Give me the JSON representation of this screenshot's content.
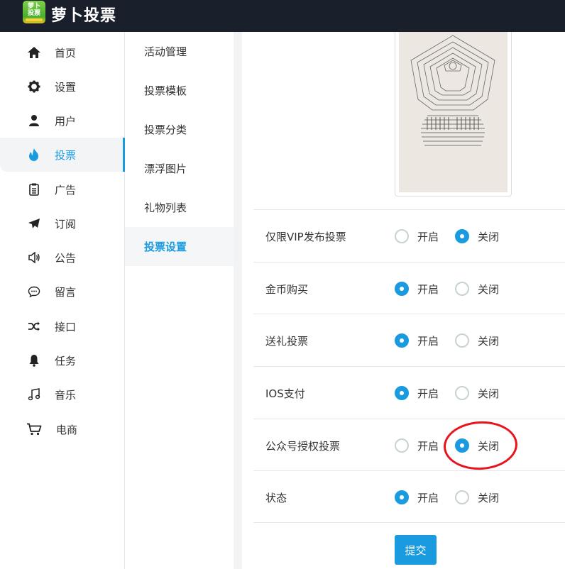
{
  "app": {
    "logo_text_line1": "萝卜",
    "logo_text_line2": "投票",
    "title": "萝卜投票"
  },
  "sidebar": {
    "items": [
      {
        "label": "首页",
        "icon": "home-icon"
      },
      {
        "label": "设置",
        "icon": "gear-icon"
      },
      {
        "label": "用户",
        "icon": "user-icon"
      },
      {
        "label": "投票",
        "icon": "fire-icon",
        "active": true
      },
      {
        "label": "广告",
        "icon": "clipboard-icon"
      },
      {
        "label": "订阅",
        "icon": "paper-plane-icon"
      },
      {
        "label": "公告",
        "icon": "speaker-icon"
      },
      {
        "label": "留言",
        "icon": "chat-bubble-icon"
      },
      {
        "label": "接口",
        "icon": "shuffle-icon"
      },
      {
        "label": "任务",
        "icon": "bell-icon"
      },
      {
        "label": "音乐",
        "icon": "music-note-icon"
      },
      {
        "label": "电商",
        "icon": "cart-icon"
      }
    ]
  },
  "subnav": {
    "items": [
      {
        "label": "活动管理"
      },
      {
        "label": "投票模板"
      },
      {
        "label": "投票分类"
      },
      {
        "label": "漂浮图片"
      },
      {
        "label": "礼物列表"
      },
      {
        "label": "投票设置",
        "active": true
      }
    ]
  },
  "settings": {
    "open_label": "开启",
    "close_label": "关闭",
    "rows": [
      {
        "label": "仅限VIP发布投票",
        "value": "关闭"
      },
      {
        "label": "金币购买",
        "value": "开启"
      },
      {
        "label": "送礼投票",
        "value": "开启"
      },
      {
        "label": "IOS支付",
        "value": "开启"
      },
      {
        "label": "公众号授权投票",
        "value": "关闭"
      },
      {
        "label": "状态",
        "value": "开启"
      }
    ],
    "submit_label": "提交"
  },
  "colors": {
    "accent": "#1a9be0",
    "header_bg": "#1a1f2c",
    "annotation": "#e8131b"
  }
}
